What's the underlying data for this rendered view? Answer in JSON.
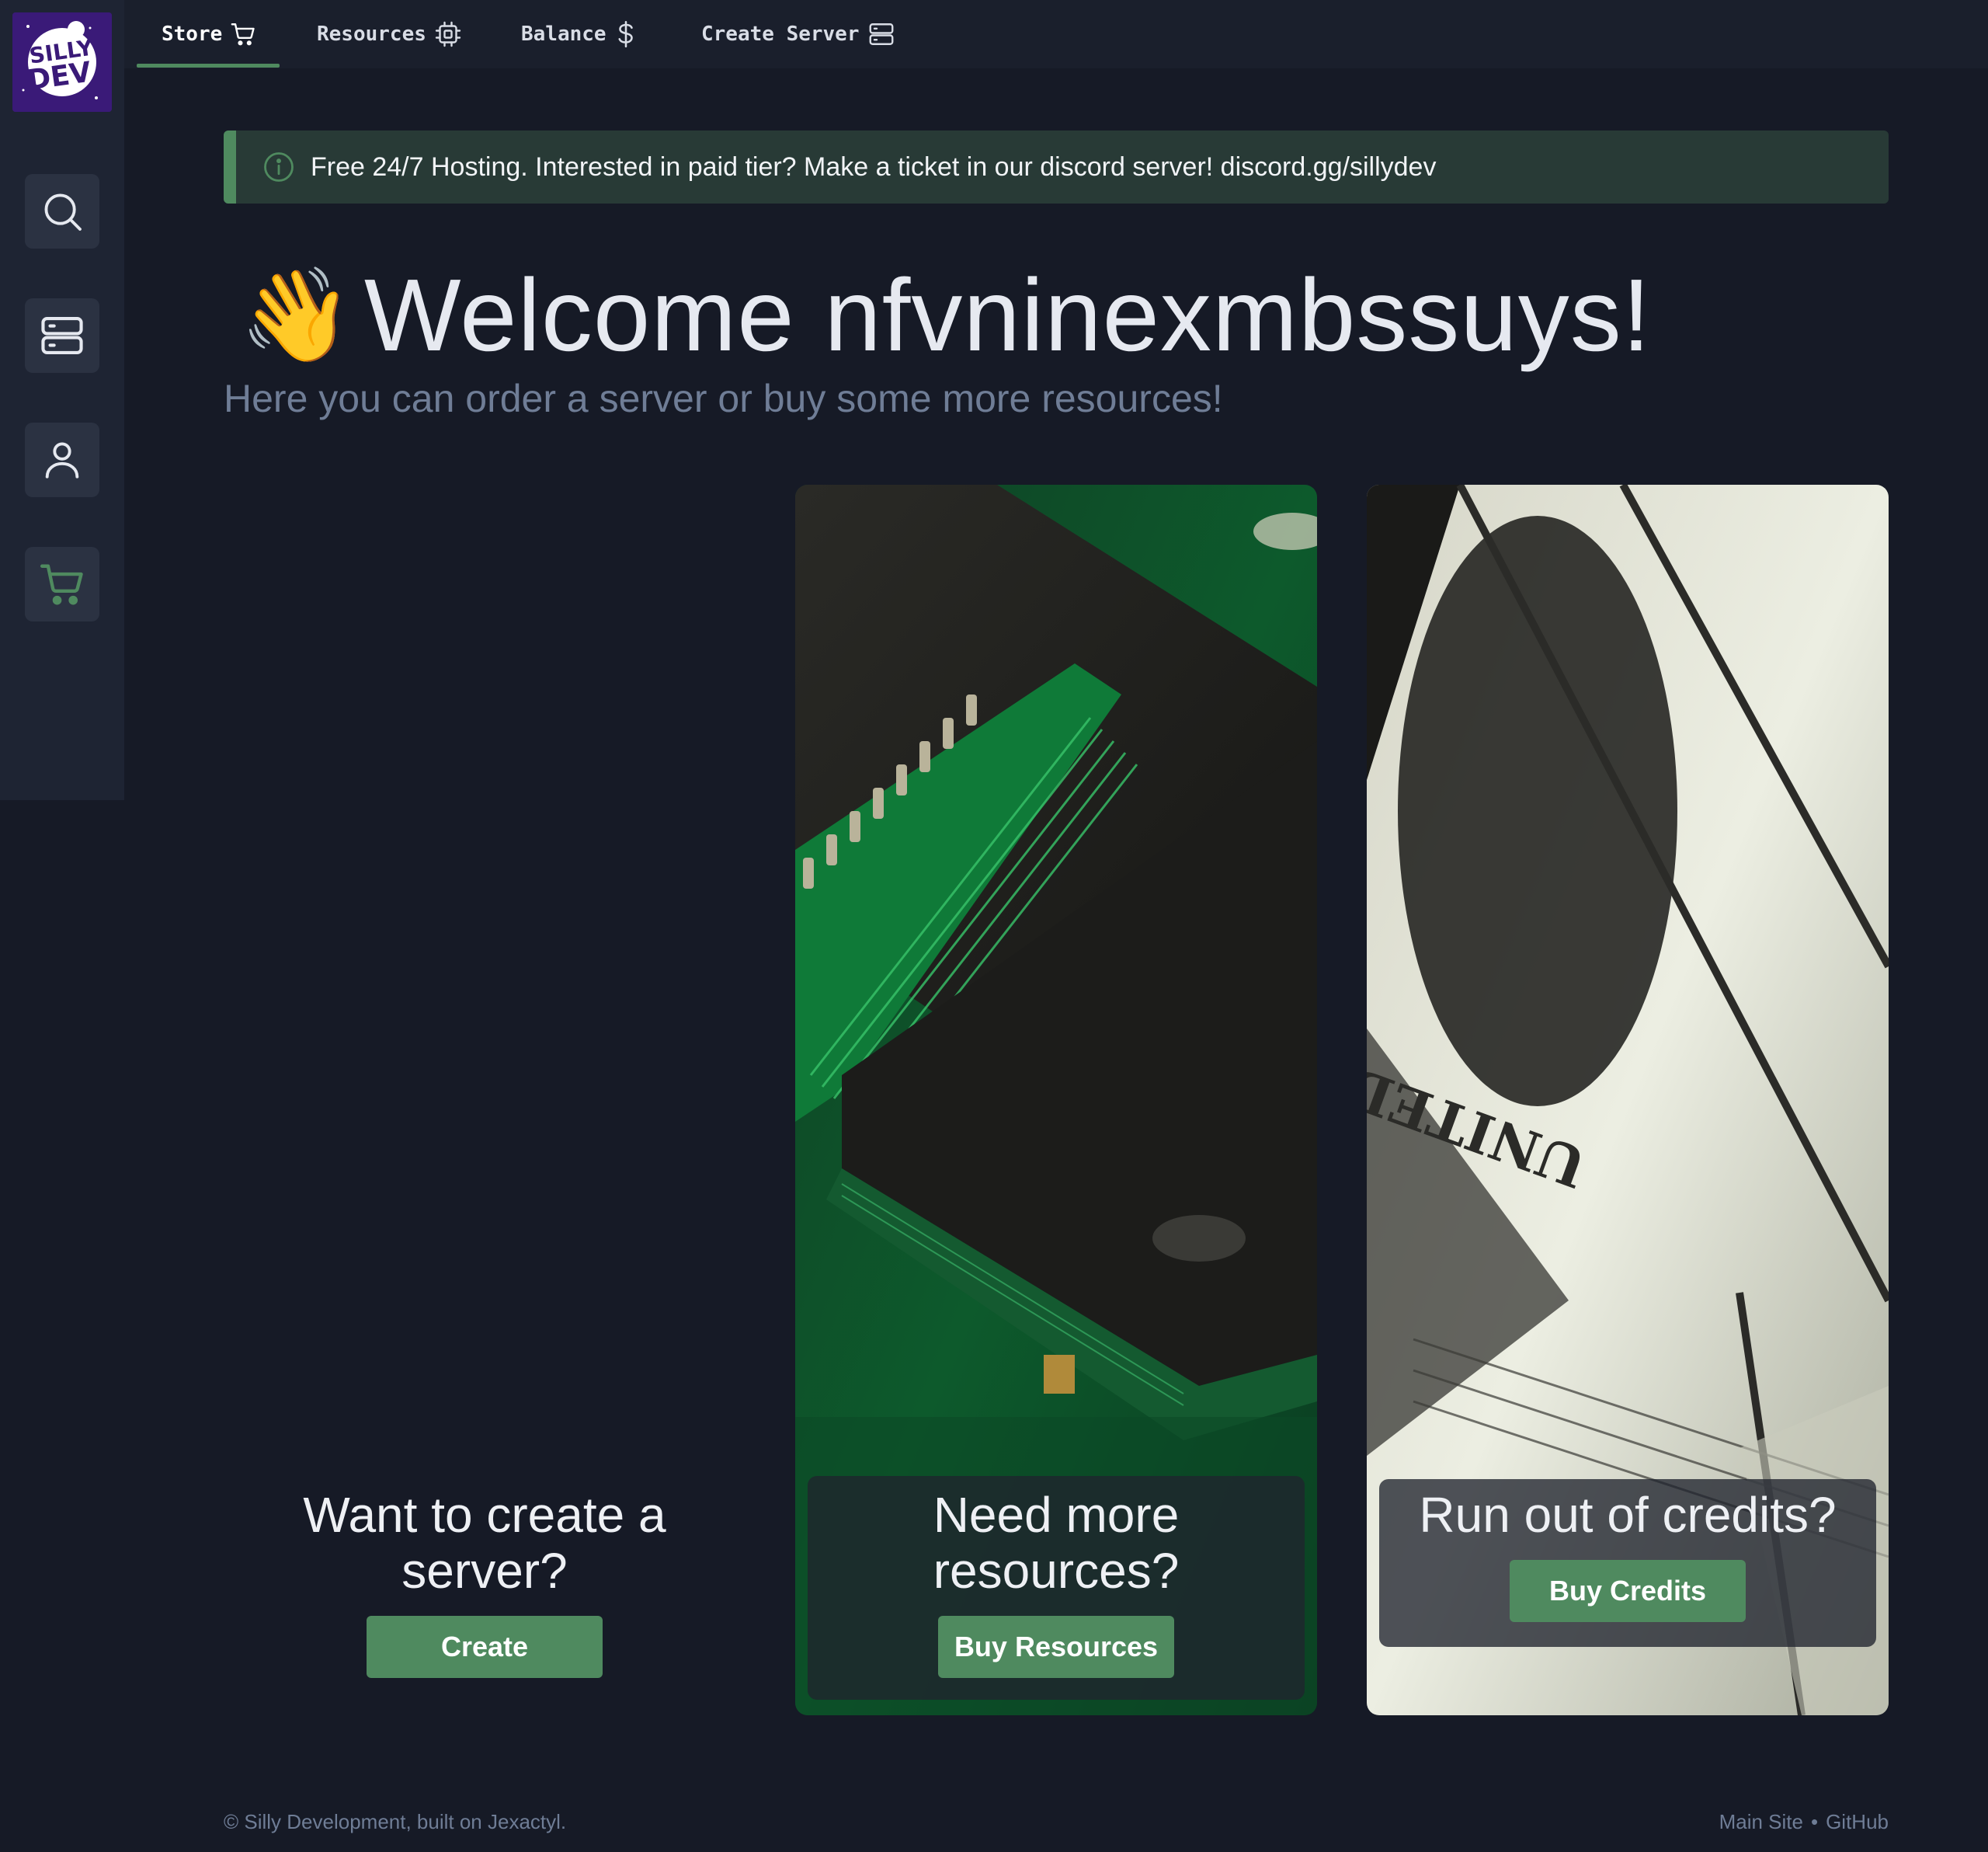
{
  "brand": {
    "logo_text_top": "SILLY",
    "logo_text_bottom": "DEV"
  },
  "nav": {
    "tabs": [
      {
        "label": "Store",
        "icon": "cart-icon",
        "active": true
      },
      {
        "label": "Resources",
        "icon": "chip-icon"
      },
      {
        "label": "Balance",
        "icon": "dollar-icon"
      },
      {
        "label": "Create Server",
        "icon": "server-icon"
      }
    ]
  },
  "sidebar": {
    "items": [
      {
        "icon": "search-icon"
      },
      {
        "icon": "server-icon"
      },
      {
        "icon": "user-icon"
      },
      {
        "icon": "cart-icon",
        "color": "#4f8a5f"
      }
    ]
  },
  "alert": {
    "icon": "info-icon",
    "text": "Free 24/7 Hosting. Interested in paid tier? Make a ticket in our discord server! discord.gg/sillydev"
  },
  "hero": {
    "emoji": "👋",
    "title": "Welcome nfvninexmbssuys!",
    "subtitle": "Here you can order a server or buy some more resources!"
  },
  "cards": [
    {
      "title_line1": "Want to create a",
      "title_line2": "server?",
      "button": "Create"
    },
    {
      "title_line1": "Need more",
      "title_line2": "resources?",
      "button": "Buy Resources",
      "image": "circuit-board-image"
    },
    {
      "title_line1": "Run out of credits?",
      "button": "Buy Credits",
      "image": "dollar-bills-image"
    }
  ],
  "footer": {
    "copyright": "© Silly Development, built on Jexactyl.",
    "links": [
      "Main Site",
      "GitHub"
    ],
    "separator": "•"
  },
  "colors": {
    "accent": "#4f8a5f",
    "background": "#161a26",
    "sidebar": "#1e2433"
  }
}
